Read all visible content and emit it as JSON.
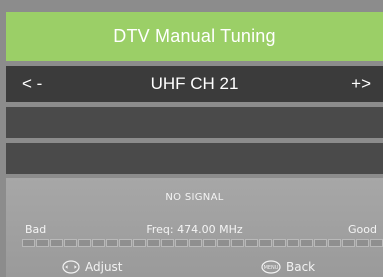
{
  "title": "DTV Manual Tuning",
  "channel": {
    "prev_label": "< -",
    "value": "UHF CH 21",
    "next_label": "+>"
  },
  "info": {
    "status": "NO SIGNAL",
    "bad_label": "Bad",
    "freq": "Freq: 474.00 MHz",
    "good_label": "Good",
    "signal_level": 0,
    "signal_segments": 26
  },
  "hints": {
    "adjust_label": "Adjust",
    "adjust_icon": "nav-arrows-icon",
    "back_label": "Back",
    "back_icon_text": "MENU",
    "back_icon": "menu-button-icon"
  }
}
